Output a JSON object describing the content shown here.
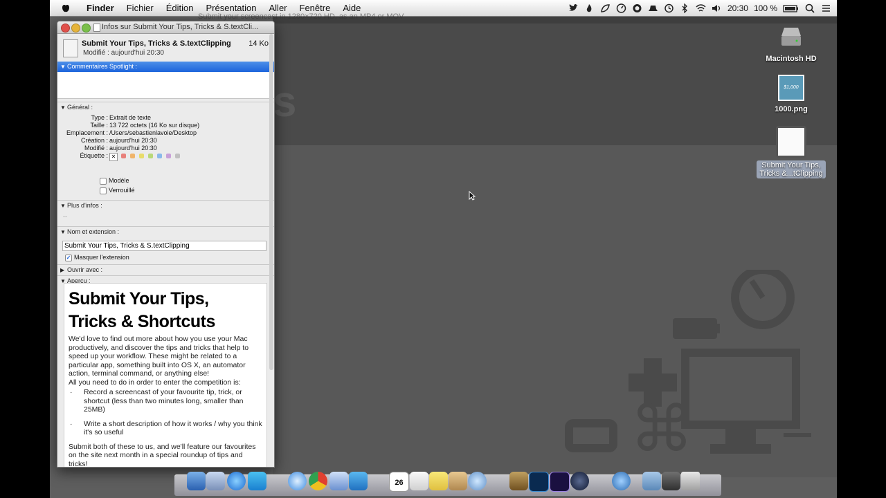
{
  "menubar": {
    "items": [
      "Finder",
      "Fichier",
      "Édition",
      "Présentation",
      "Aller",
      "Fenêtre",
      "Aide"
    ],
    "clock": "20:30",
    "battery": "100 %"
  },
  "background_title": "Submit your screencast in 1280×720 HD, as an MP4 or MOV",
  "desktop": {
    "icons": [
      {
        "label": "Macintosh HD"
      },
      {
        "label": "1000.png"
      },
      {
        "label1": "Submit Your Tips,",
        "label2": "Tricks &...tClipping"
      }
    ],
    "thumb_text": "$1,000"
  },
  "info_window": {
    "title": "Infos sur Submit Your Tips, Tricks & S.textCli...",
    "file_name": "Submit Your Tips, Tricks & S.textClipping",
    "file_size": "14 Ko",
    "modified_line": "Modifié : aujourd'hui 20:30",
    "sections": {
      "spotlight": "Commentaires Spotlight :",
      "general": "Général :",
      "more_info": "Plus d'infos :",
      "name_ext": "Nom et extension :",
      "open_with": "Ouvrir avec :",
      "preview": "Aperçu :"
    },
    "general": {
      "type_k": "Type :",
      "type_v": "Extrait de texte",
      "size_k": "Taille :",
      "size_v": "13 722 octets (16 Ko sur disque)",
      "loc_k": "Emplacement :",
      "loc_v": "/Users/sebastienlavoie/Desktop",
      "created_k": "Création :",
      "created_v": "aujourd'hui 20:30",
      "modified_k": "Modifié :",
      "modified_v": "aujourd'hui 20:30",
      "label_k": "Étiquette :",
      "template": "Modèle",
      "locked": "Verrouillé"
    },
    "more_info_value": "--",
    "name_field": "Submit Your Tips, Tricks & S.textClipping",
    "hide_extension": "Masquer l'extension",
    "label_colors": [
      "#e8807b",
      "#f0b46a",
      "#e8dc6a",
      "#b8d878",
      "#8ab8ea",
      "#c8a0d8",
      "#c0c0c0"
    ]
  },
  "preview": {
    "heading1": "Submit Your Tips,",
    "heading2": "Tricks & Shortcuts",
    "p1": "We'd love to find out more about how you use your Mac productively, and discover the tips and tricks that help to speed up your workflow. These might be related to a particular app, something built into OS X, an automator action, terminal command, or anything else!",
    "p2": "All you need to do in order to enter the competition is:",
    "li1": "Record a screencast of your favourite tip, trick, or shortcut (less than two minutes long, smaller than 25MB)",
    "li2": "Write a short description of how it works / why you think it's so useful",
    "p3": "Submit both of these to us, and we'll feature our favourites on the site next month in a special roundup of tips and tricks!"
  },
  "dock": {
    "calendar_day": "26"
  }
}
